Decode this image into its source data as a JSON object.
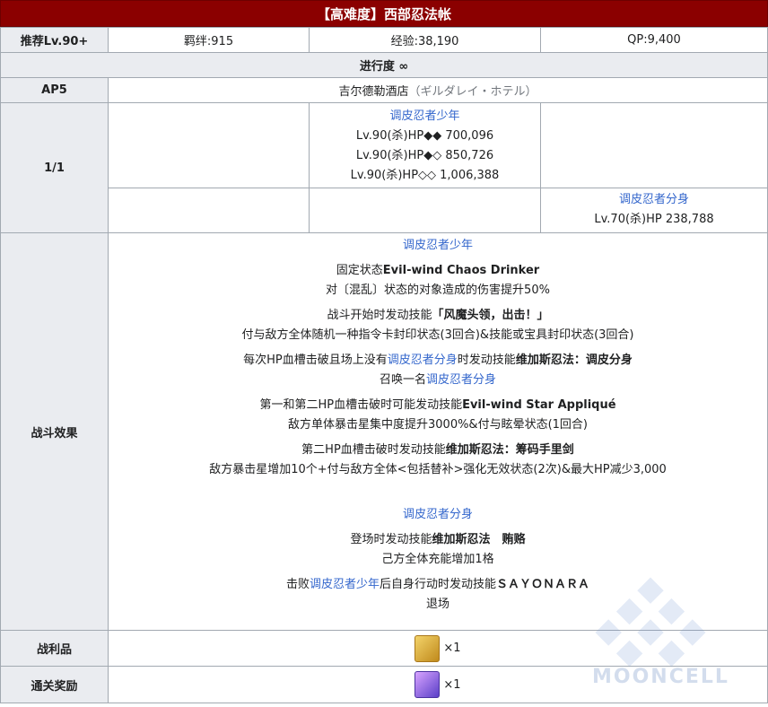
{
  "title": "【高难度】西部忍法帐",
  "row1": {
    "label": "推荐Lv.90+",
    "bond": "羁绊:915",
    "exp": "经验:38,190",
    "qp": "QP:9,400"
  },
  "progress": "进行度 ∞",
  "ap_row": {
    "label": "AP5",
    "location": "吉尔德勒酒店",
    "location_jp": "（ギルダレイ・ホテル）"
  },
  "wave": {
    "label": "1/1",
    "enemy1": {
      "name": "调皮忍者少年",
      "hp1": "Lv.90(杀)HP◆◆ 700,096",
      "hp2": "Lv.90(杀)HP◆◇ 850,726",
      "hp3": "Lv.90(杀)HP◇◇ 1,006,388"
    },
    "enemy2": {
      "name": "调皮忍者分身",
      "hp": "Lv.70(杀)HP 238,788"
    }
  },
  "effects": {
    "label": "战斗效果",
    "boy_name": "调皮忍者少年",
    "l1a": "固定状态",
    "l1b": "Evil-wind Chaos Drinker",
    "l2": "对〔混乱〕状态的对象造成的伤害提升50%",
    "l3a": "战斗开始时发动技能",
    "l3b": "「风魔头领，出击！」",
    "l4": "付与敌方全体随机一种指令卡封印状态(3回合)&技能或宝具封印状态(3回合)",
    "l5a": "每次HP血槽击破且场上没有",
    "l5b": "调皮忍者分身",
    "l5c": "时发动技能",
    "l5d": "维加斯忍法：调皮分身",
    "l6a": "召唤一名",
    "l6b": "调皮忍者分身",
    "l7a": "第一和第二HP血槽击破时可能发动技能",
    "l7b": "Evil-wind Star Appliqué",
    "l8": "敌方单体暴击星集中度提升3000%&付与眩晕状态(1回合)",
    "l9a": "第二HP血槽击破时发动技能",
    "l9b": "维加斯忍法：筹码手里剑",
    "l10": "敌方暴击星增加10个+付与敌方全体<包括替补>强化无效状态(2次)&最大HP减少3,000",
    "clone_name": "调皮忍者分身",
    "l11a": "登场时发动技能",
    "l11b": "维加斯忍法　贿赂",
    "l12": "己方全体充能增加1格",
    "l13a": "击败",
    "l13b": "调皮忍者少年",
    "l13c": "后自身行动时发动技能",
    "l13d": "ＳＡＹＯＮＡＲＡ",
    "l14": "退场"
  },
  "loot": {
    "label": "战利品",
    "count": "×1"
  },
  "clear": {
    "label": "通关奖励",
    "count": "×1"
  },
  "watermark": "MOONCELL"
}
